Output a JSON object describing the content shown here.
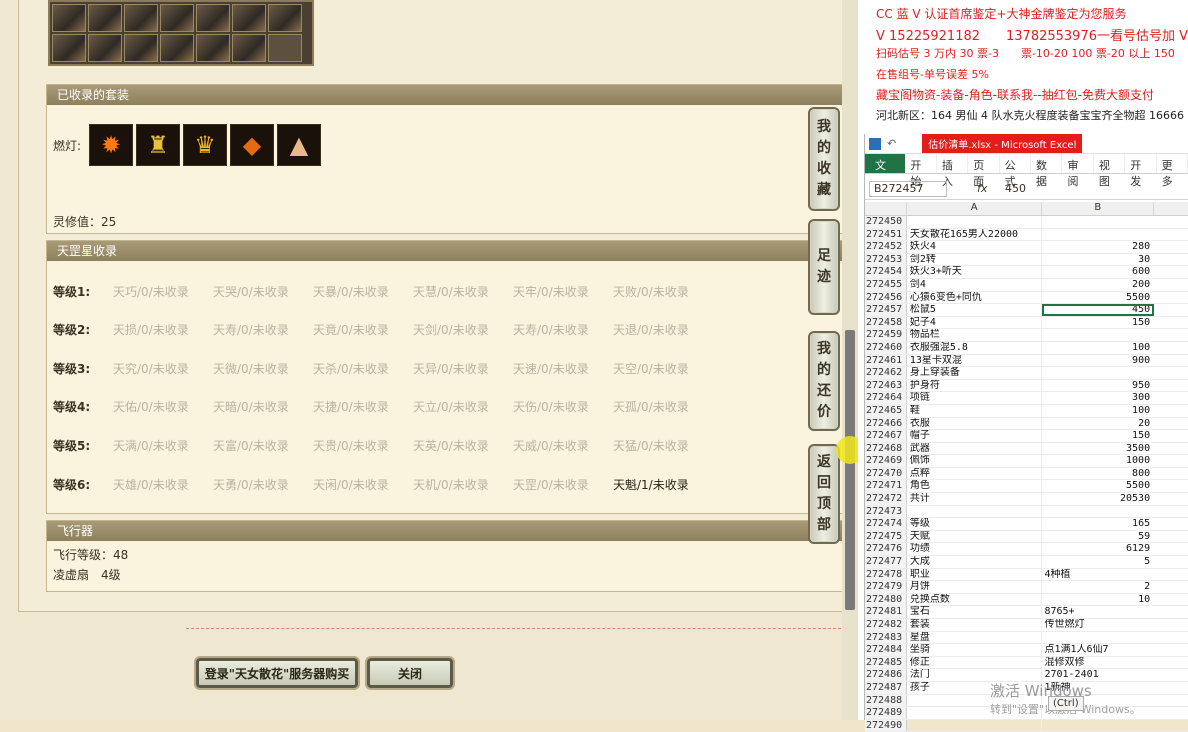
{
  "game": {
    "collected_sets": {
      "title": "已收录的套装",
      "lamp_label": "燃灯:",
      "lamp_icons": [
        "flame-icon",
        "robe-icon",
        "helmet-icon",
        "gem-icon",
        "cloak-icon"
      ],
      "ling_label": "灵修值：25"
    },
    "tiangang": {
      "title": "天罡星收录",
      "rows": [
        {
          "level": "等级1:",
          "cells": [
            "天巧/0/未收录",
            "天哭/0/未收录",
            "天暴/0/未收录",
            "天慧/0/未收录",
            "天牢/0/未收录",
            "天败/0/未收录"
          ]
        },
        {
          "level": "等级2:",
          "cells": [
            "天损/0/未收录",
            "天寿/0/未收录",
            "天竟/0/未收录",
            "天剑/0/未收录",
            "天寿/0/未收录",
            "天退/0/未收录"
          ]
        },
        {
          "level": "等级3:",
          "cells": [
            "天究/0/未收录",
            "天微/0/未收录",
            "天杀/0/未收录",
            "天异/0/未收录",
            "天速/0/未收录",
            "天空/0/未收录"
          ]
        },
        {
          "level": "等级4:",
          "cells": [
            "天佑/0/未收录",
            "天暗/0/未收录",
            "天捷/0/未收录",
            "天立/0/未收录",
            "天伤/0/未收录",
            "天孤/0/未收录"
          ]
        },
        {
          "level": "等级5:",
          "cells": [
            "天满/0/未收录",
            "天富/0/未收录",
            "天贵/0/未收录",
            "天英/0/未收录",
            "天威/0/未收录",
            "天猛/0/未收录"
          ]
        },
        {
          "level": "等级6:",
          "cells": [
            "天雄/0/未收录",
            "天勇/0/未收录",
            "天闲/0/未收录",
            "天机/0/未收录",
            "天罡/0/未收录",
            "天魁/1/未收录"
          ]
        }
      ]
    },
    "flight": {
      "title": "飞行器",
      "level": "飞行等级：48",
      "item": "凌虚扇　4级"
    },
    "side_tabs": [
      "我的收藏",
      "足迹",
      "我的还价",
      "返回顶部"
    ],
    "buttons": {
      "register": "登录\"天女散花\"服务器购买",
      "close": "关闭"
    }
  },
  "ads": [
    {
      "text": "CC 蓝 V 认证首席鉴定+大神金牌鉴定为您服务",
      "style": "red"
    },
    {
      "text": "V 15225921182　　13782553976一看号估号加 V",
      "style": "red"
    },
    {
      "text": "扫码估号 3 万内 30 票-3　　票-10-20 100 票-20 以上 150",
      "style": "red"
    },
    {
      "text": "在售组号-单号误差 5%",
      "style": "red"
    },
    {
      "text": "藏宝阁物资-装备-角色-联系我--抽红包-免费大额支付",
      "style": "red"
    },
    {
      "text": "河北新区：164 男仙 4 队水克火程度装备宝宝齐全物超 16666",
      "style": "dark"
    }
  ],
  "excel": {
    "title_doc": "估价清单.xlsx - Microsoft Excel",
    "ribbon_file": "文件",
    "ribbon_tabs": [
      "开始",
      "插入",
      "页面",
      "公式",
      "数据",
      "审阅",
      "视图",
      "开发",
      "更多"
    ],
    "name_box": "B272457",
    "fx": "fx",
    "formula": "450",
    "col_a": "A",
    "col_b": "B",
    "rows": [
      {
        "n": "272450",
        "a": "",
        "b": ""
      },
      {
        "n": "272451",
        "a": "天女散花165男人22000",
        "b": ""
      },
      {
        "n": "272452",
        "a": "妖火4",
        "b": "280"
      },
      {
        "n": "272453",
        "a": "剑2转",
        "b": "30"
      },
      {
        "n": "272454",
        "a": "妖火3+听天",
        "b": "600"
      },
      {
        "n": "272455",
        "a": "剑4",
        "b": "200"
      },
      {
        "n": "272456",
        "a": "心猿6变色+同仇",
        "b": "5500"
      },
      {
        "n": "272457",
        "a": "松鼠5",
        "b": "450"
      },
      {
        "n": "272458",
        "a": "妃子4",
        "b": "150"
      },
      {
        "n": "272459",
        "a": "物品栏",
        "b": ""
      },
      {
        "n": "272460",
        "a": "衣服强混5.8",
        "b": "100"
      },
      {
        "n": "272461",
        "a": "13星卡双混",
        "b": "900"
      },
      {
        "n": "272462",
        "a": "身上穿装备",
        "b": ""
      },
      {
        "n": "272463",
        "a": "护身符",
        "b": "950"
      },
      {
        "n": "272464",
        "a": "项链",
        "b": "300"
      },
      {
        "n": "272465",
        "a": "鞋",
        "b": "100"
      },
      {
        "n": "272466",
        "a": "衣服",
        "b": "20"
      },
      {
        "n": "272467",
        "a": "帽子",
        "b": "150"
      },
      {
        "n": "272468",
        "a": "武器",
        "b": "3500"
      },
      {
        "n": "272469",
        "a": "佩饰",
        "b": "1000"
      },
      {
        "n": "272470",
        "a": "点粹",
        "b": "800"
      },
      {
        "n": "272471",
        "a": "角色",
        "b": "5500"
      },
      {
        "n": "272472",
        "a": "共计",
        "b": "20530"
      },
      {
        "n": "272473",
        "a": "",
        "b": ""
      },
      {
        "n": "272474",
        "a": "等级",
        "b": "165"
      },
      {
        "n": "272475",
        "a": "天赋",
        "b": "59"
      },
      {
        "n": "272476",
        "a": "功绩",
        "b": "6129"
      },
      {
        "n": "272477",
        "a": "大成",
        "b": "5"
      },
      {
        "n": "272478",
        "a": "职业",
        "b": "4种植",
        "left": true
      },
      {
        "n": "272479",
        "a": "月饼",
        "b": "2"
      },
      {
        "n": "272480",
        "a": "兑换点数",
        "b": "10"
      },
      {
        "n": "272481",
        "a": "宝石",
        "b": "8765+",
        "left": true
      },
      {
        "n": "272482",
        "a": "套装",
        "b": "传世燃灯",
        "left": true
      },
      {
        "n": "272483",
        "a": "星盘",
        "b": "",
        "left": true
      },
      {
        "n": "272484",
        "a": "坐骑",
        "b": "点1满1人6仙7",
        "left": true
      },
      {
        "n": "272485",
        "a": "修正",
        "b": "混修双修",
        "left": true
      },
      {
        "n": "272486",
        "a": "法门",
        "b": "2701-2401",
        "left": true
      },
      {
        "n": "272487",
        "a": "孩子",
        "b": "1新神",
        "left": true
      },
      {
        "n": "272488",
        "a": "",
        "b": ""
      },
      {
        "n": "272489",
        "a": "",
        "b": ""
      },
      {
        "n": "272490",
        "a": "",
        "b": ""
      }
    ],
    "paste_ctrl": "(Ctrl)",
    "activate": "激活 Windows",
    "activate_sub": "转到\"设置\"以激活 Windows。"
  }
}
